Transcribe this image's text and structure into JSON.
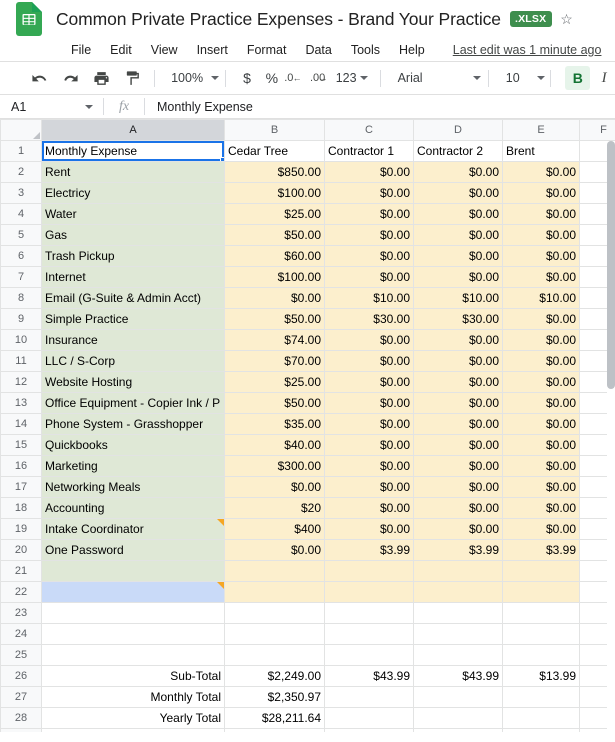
{
  "app": {
    "logo_icon": "google-sheets-icon",
    "title": "Common Private Practice Expenses - Brand Your Practice",
    "file_type_badge": ".XLSX",
    "star_icon": "star-icon"
  },
  "menubar": {
    "items": [
      "File",
      "Edit",
      "View",
      "Insert",
      "Format",
      "Data",
      "Tools",
      "Help"
    ],
    "last_edit": "Last edit was 1 minute ago"
  },
  "toolbar": {
    "undo_icon": "undo-icon",
    "redo_icon": "redo-icon",
    "print_icon": "print-icon",
    "paint_format_icon": "paint-format-icon",
    "zoom": "100%",
    "currency_icon": "$",
    "percent_icon": "%",
    "decrease_decimal_icon": ".0",
    "decrease_decimal_arrow": "←",
    "increase_decimal_icon": ".00",
    "increase_decimal_arrow": "→",
    "number_format": "123",
    "font_family": "Arial",
    "font_size": "10",
    "bold_label": "B",
    "italic_label": "I",
    "accent_color": "#3e8e4e",
    "bold_active_bg": "#e6f4ea",
    "bold_active_fg": "#137333"
  },
  "formula_bar": {
    "name_box": "A1",
    "fx_icon": "function-icon",
    "value": "Monthly Expense"
  },
  "grid": {
    "columns": [
      "A",
      "B",
      "C",
      "D",
      "E",
      "F"
    ],
    "selected_column": "A",
    "selected_cell": "A1",
    "colors": {
      "green_fill": "#dfe8d6",
      "cream_fill": "#fcefcd",
      "blue_fill": "#c9daf8",
      "selection_border": "#1a73e8",
      "note_marker": "#f5a623"
    },
    "headers": {
      "a": "Monthly Expense",
      "b": "Cedar Tree",
      "c": "Contractor 1",
      "d": "Contractor 2",
      "e": "Brent"
    },
    "rows": [
      {
        "n": 2,
        "a": "Rent",
        "b": "$850.00",
        "c": "$0.00",
        "d": "$0.00",
        "e": "$0.00",
        "bold": [
          "b"
        ]
      },
      {
        "n": 3,
        "a": "Electricy",
        "b": "$100.00",
        "c": "$0.00",
        "d": "$0.00",
        "e": "$0.00",
        "bold": []
      },
      {
        "n": 4,
        "a": "Water",
        "b": "$25.00",
        "c": "$0.00",
        "d": "$0.00",
        "e": "$0.00",
        "bold": []
      },
      {
        "n": 5,
        "a": "Gas",
        "b": "$50.00",
        "c": "$0.00",
        "d": "$0.00",
        "e": "$0.00",
        "bold": []
      },
      {
        "n": 6,
        "a": "Trash Pickup",
        "b": "$60.00",
        "c": "$0.00",
        "d": "$0.00",
        "e": "$0.00",
        "bold": []
      },
      {
        "n": 7,
        "a": "Internet",
        "b": "$100.00",
        "c": "$0.00",
        "d": "$0.00",
        "e": "$0.00",
        "bold": []
      },
      {
        "n": 8,
        "a": "Email (G-Suite & Admin Acct)",
        "b": "$0.00",
        "c": "$10.00",
        "d": "$10.00",
        "e": "$10.00",
        "bold": [
          "c",
          "d",
          "e"
        ]
      },
      {
        "n": 9,
        "a": "Simple Practice",
        "b": "$50.00",
        "c": "$30.00",
        "d": "$30.00",
        "e": "$0.00",
        "bold": [
          "c",
          "d"
        ]
      },
      {
        "n": 10,
        "a": "Insurance",
        "b": "$74.00",
        "c": "$0.00",
        "d": "$0.00",
        "e": "$0.00",
        "bold": []
      },
      {
        "n": 11,
        "a": "LLC / S-Corp",
        "b": "$70.00",
        "c": "$0.00",
        "d": "$0.00",
        "e": "$0.00",
        "bold": []
      },
      {
        "n": 12,
        "a": "Website Hosting",
        "b": "$25.00",
        "c": "$0.00",
        "d": "$0.00",
        "e": "$0.00",
        "bold": []
      },
      {
        "n": 13,
        "a": "Office Equipment - Copier Ink / P",
        "b": "$50.00",
        "c": "$0.00",
        "d": "$0.00",
        "e": "$0.00",
        "bold": []
      },
      {
        "n": 14,
        "a": "Phone System - Grasshopper",
        "b": "$35.00",
        "c": "$0.00",
        "d": "$0.00",
        "e": "$0.00",
        "bold": []
      },
      {
        "n": 15,
        "a": "Quickbooks",
        "b": "$40.00",
        "c": "$0.00",
        "d": "$0.00",
        "e": "$0.00",
        "bold": []
      },
      {
        "n": 16,
        "a": "Marketing",
        "b": "$300.00",
        "c": "$0.00",
        "d": "$0.00",
        "e": "$0.00",
        "bold": []
      },
      {
        "n": 17,
        "a": "Networking Meals",
        "b": "$0.00",
        "c": "$0.00",
        "d": "$0.00",
        "e": "$0.00",
        "bold": []
      },
      {
        "n": 18,
        "a": "Accounting",
        "b": "$20",
        "c": "$0.00",
        "d": "$0.00",
        "e": "$0.00",
        "bold": []
      },
      {
        "n": 19,
        "a": "Intake Coordinator",
        "b": "$400",
        "c": "$0.00",
        "d": "$0.00",
        "e": "$0.00",
        "bold": [],
        "note": true
      },
      {
        "n": 20,
        "a": "One Password",
        "b": "$0.00",
        "c": "$3.99",
        "d": "$3.99",
        "e": "$3.99",
        "bold": []
      }
    ],
    "totals": [
      {
        "n": 26,
        "label": "Sub-Total",
        "b": "$2,249.00",
        "c": "$43.99",
        "d": "$43.99",
        "e": "$13.99"
      },
      {
        "n": 27,
        "label": "Monthly Total",
        "b": "$2,350.97",
        "c": "",
        "d": "",
        "e": ""
      },
      {
        "n": 28,
        "label": "Yearly Total",
        "b": "$28,211.64",
        "c": "",
        "d": "",
        "e": ""
      }
    ]
  }
}
